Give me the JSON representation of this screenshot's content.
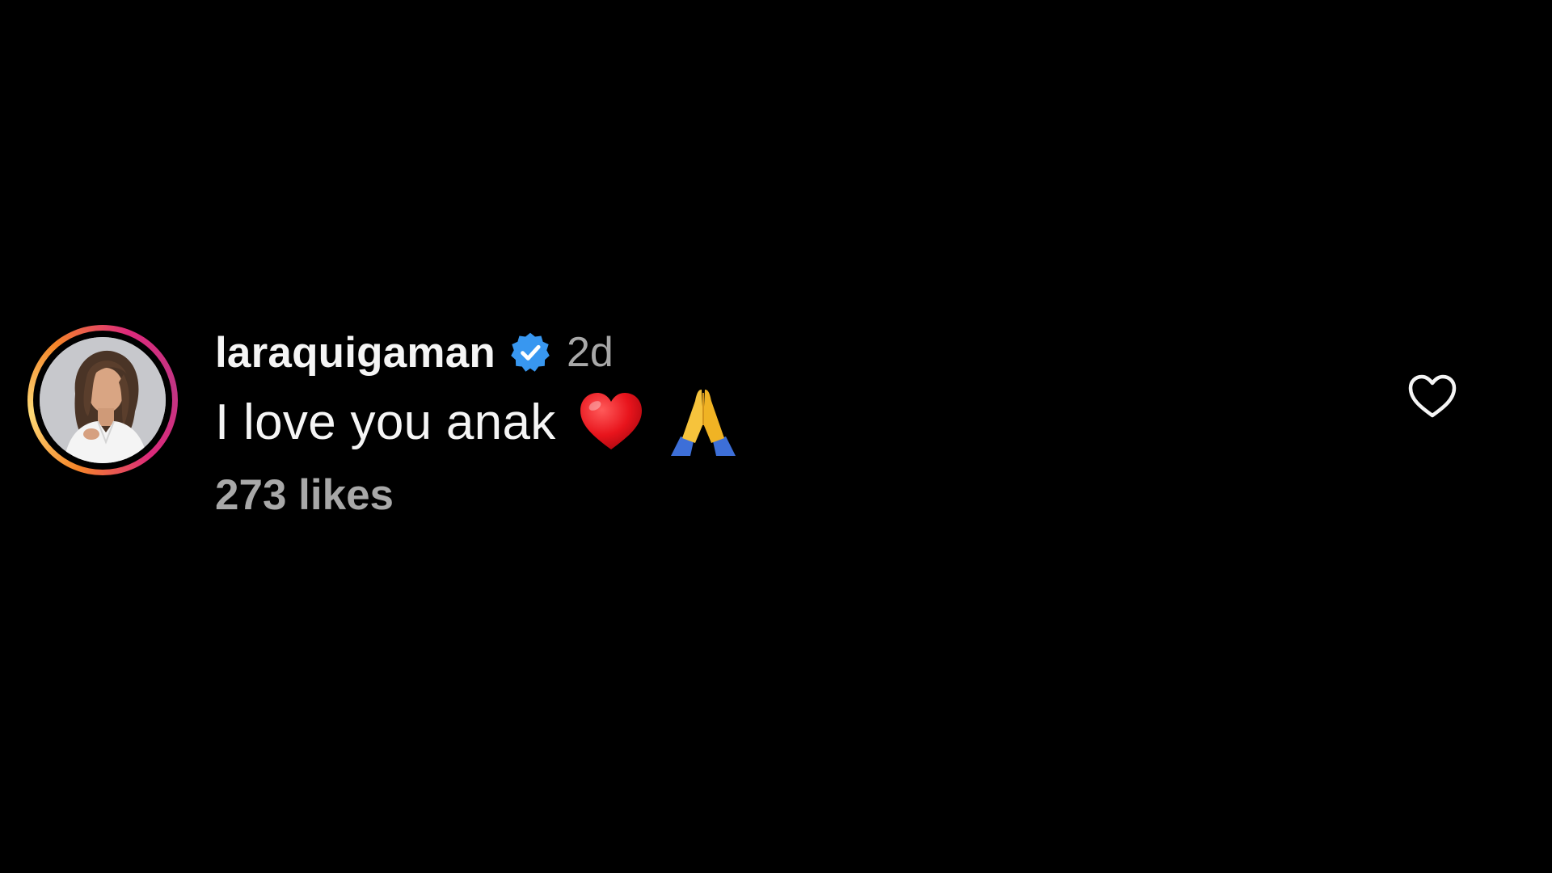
{
  "comment": {
    "username": "laraquigaman",
    "verified_icon": "verified-badge-icon",
    "time_ago": "2d",
    "text": "I love you anak",
    "emojis": [
      "red-heart-emoji",
      "folded-hands-emoji"
    ],
    "likes": "273 likes",
    "like_icon": "heart-outline-icon"
  },
  "colors": {
    "background": "#000000",
    "primary_text": "#f5f5f5",
    "secondary_text": "#a8a8a8",
    "verified_blue": "#3897f0"
  }
}
